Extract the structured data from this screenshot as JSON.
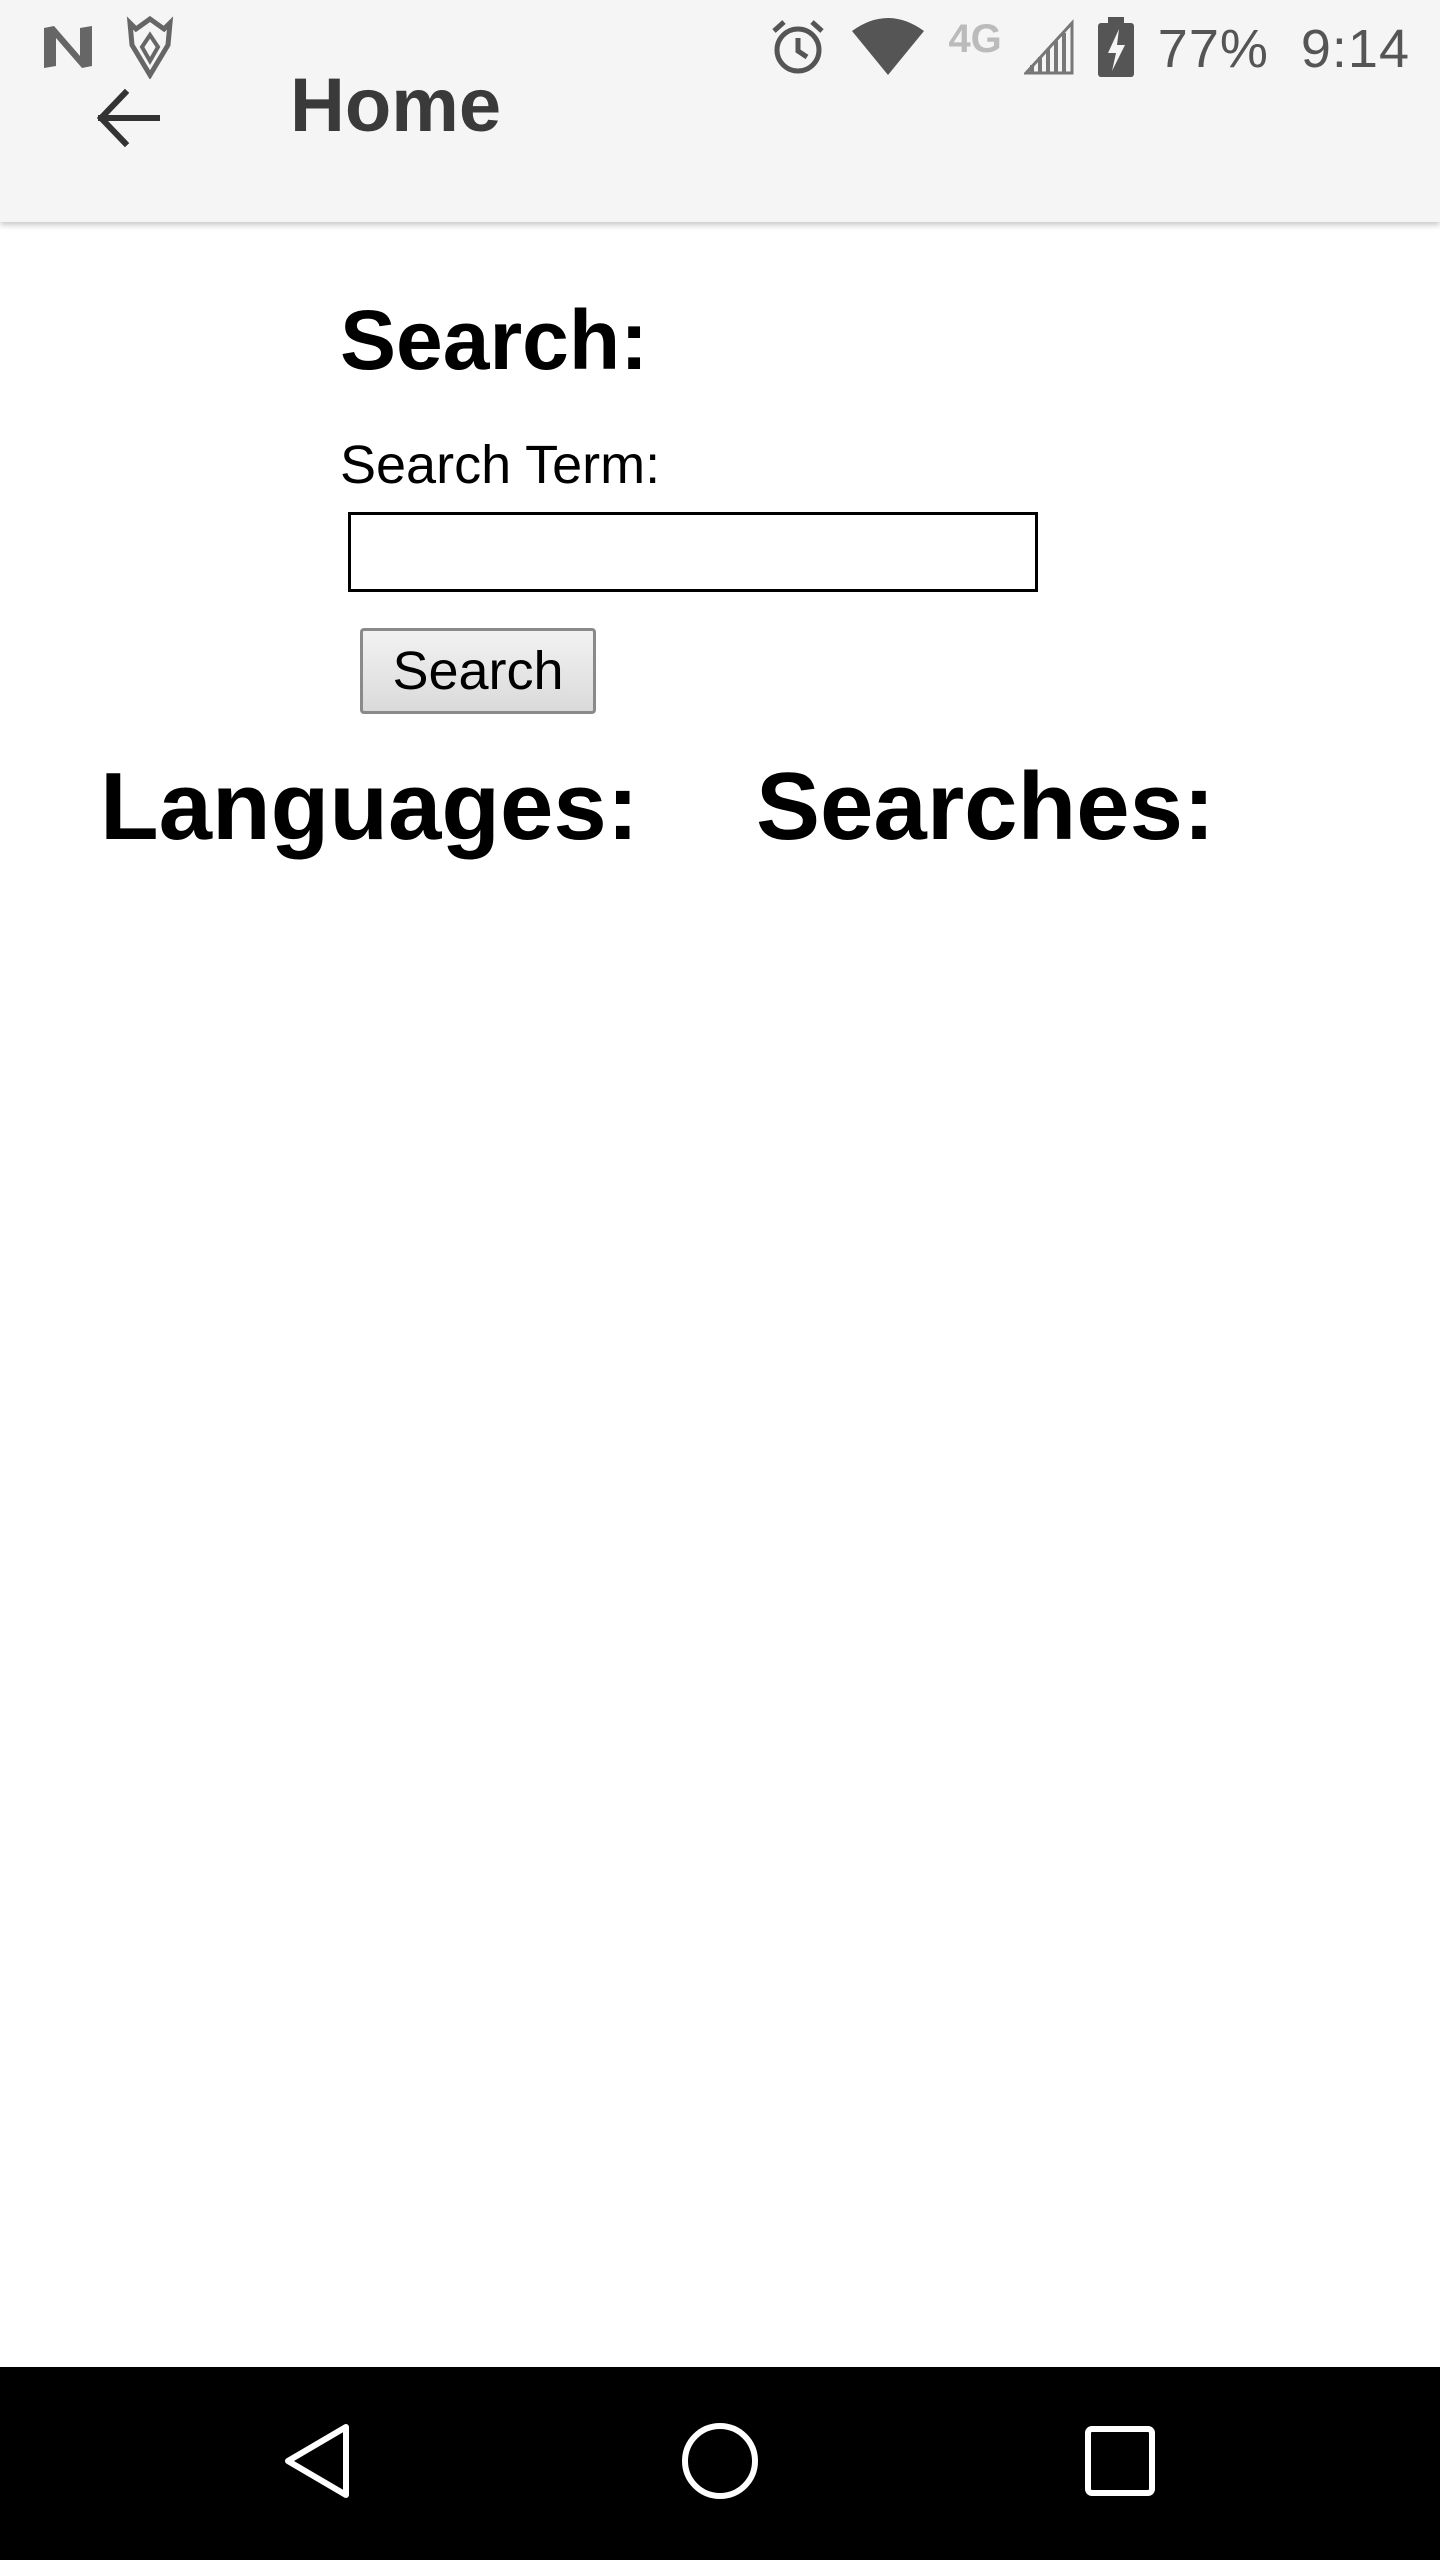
{
  "status_bar": {
    "icons": [
      "n-icon",
      "shield-app-icon",
      "alarm-icon",
      "wifi-icon",
      "4g-lte-icon",
      "signal-icon",
      "battery-charging-icon"
    ],
    "network": "4G",
    "battery_percent": "77%",
    "time": "9:14"
  },
  "app_bar": {
    "back_icon": "arrow-left-icon",
    "title": "Home"
  },
  "main": {
    "search_heading": "Search:",
    "search_term_label": "Search Term:",
    "search_input_value": "",
    "search_button_label": "Search",
    "languages_heading": "Languages:",
    "searches_heading": "Searches:"
  },
  "nav_bar": {
    "icons": [
      "back-triangle-icon",
      "home-circle-icon",
      "recents-square-icon"
    ]
  },
  "colors": {
    "app_bar_bg": "#f5f5f5",
    "title_text": "#3a3a3a",
    "nav_bar_bg": "#000000",
    "page_bg": "#ffffff"
  }
}
